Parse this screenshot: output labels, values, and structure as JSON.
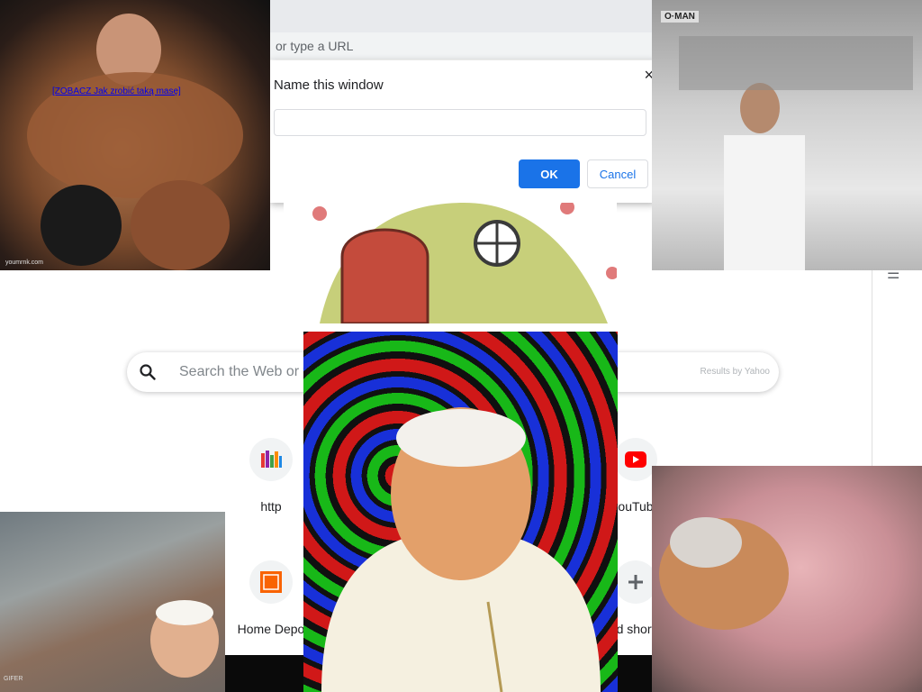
{
  "browser": {
    "omnibox_text": "or type a URL"
  },
  "ntp": {
    "search_placeholder": "Search the Web or t",
    "results_by": "Results by Yahoo",
    "shortcuts": [
      {
        "label": "http"
      },
      {
        "label": "ouTub"
      },
      {
        "label": "Home Depo"
      },
      {
        "label": "d short"
      }
    ]
  },
  "dialog": {
    "title": "Name this window",
    "close_symbol": "×",
    "input_value": "",
    "ok_label": "OK",
    "cancel_label": "Cancel"
  },
  "overlays": {
    "bodybuilder_link": "[ZOBACZ Jak zrobić taką masę]",
    "bodybuilder_watermark": "youmrnk.com",
    "butcher_logo": "O·MAN",
    "bottom_left_watermark": "GIFER"
  },
  "colors": {
    "accent": "#1a73e8",
    "youtube_red": "#ff0000",
    "homedepot_orange": "#f96302"
  }
}
